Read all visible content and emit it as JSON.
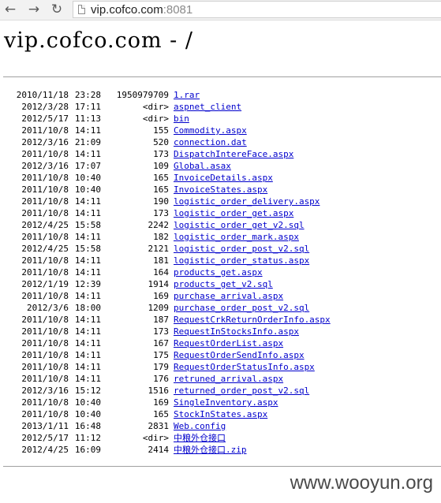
{
  "browser": {
    "back_icon": "arrow-left-icon",
    "forward_icon": "arrow-right-icon",
    "reload_icon": "reload-icon",
    "url_host": "vip.cofco.com",
    "url_port": ":8081"
  },
  "page": {
    "title": "vip.cofco.com - /"
  },
  "listing": [
    {
      "date": "2010/11/18",
      "time": "23:28",
      "size": "1950979709",
      "name": "1.rar"
    },
    {
      "date": "2012/3/28",
      "time": "17:11",
      "size": "<dir>",
      "name": "aspnet_client"
    },
    {
      "date": "2012/5/17",
      "time": "11:13",
      "size": "<dir>",
      "name": "bin"
    },
    {
      "date": "2011/10/8",
      "time": "14:11",
      "size": "155",
      "name": "Commodity.aspx"
    },
    {
      "date": "2012/3/16",
      "time": "21:09",
      "size": "520",
      "name": "connection.dat"
    },
    {
      "date": "2011/10/8",
      "time": "14:11",
      "size": "173",
      "name": "DispatchIntereFace.aspx"
    },
    {
      "date": "2012/3/16",
      "time": "17:07",
      "size": "109",
      "name": "Global.asax"
    },
    {
      "date": "2011/10/8",
      "time": "10:40",
      "size": "165",
      "name": "InvoiceDetails.aspx"
    },
    {
      "date": "2011/10/8",
      "time": "10:40",
      "size": "165",
      "name": "InvoiceStates.aspx"
    },
    {
      "date": "2011/10/8",
      "time": "14:11",
      "size": "190",
      "name": "logistic_order_delivery.aspx"
    },
    {
      "date": "2011/10/8",
      "time": "14:11",
      "size": "173",
      "name": "logistic_order_get.aspx"
    },
    {
      "date": "2012/4/25",
      "time": "15:58",
      "size": "2242",
      "name": "logistic_order_get_v2.sql"
    },
    {
      "date": "2011/10/8",
      "time": "14:11",
      "size": "182",
      "name": "logistic_order_mark.aspx"
    },
    {
      "date": "2012/4/25",
      "time": "15:58",
      "size": "2121",
      "name": "logistic_order_post_v2.sql"
    },
    {
      "date": "2011/10/8",
      "time": "14:11",
      "size": "181",
      "name": "logistic_order_status.aspx"
    },
    {
      "date": "2011/10/8",
      "time": "14:11",
      "size": "164",
      "name": "products_get.aspx"
    },
    {
      "date": "2012/1/19",
      "time": "12:39",
      "size": "1914",
      "name": "products_get_v2.sql"
    },
    {
      "date": "2011/10/8",
      "time": "14:11",
      "size": "169",
      "name": "purchase_arrival.aspx"
    },
    {
      "date": "2012/3/6",
      "time": "18:00",
      "size": "1209",
      "name": "purchase_order_post_v2.sql"
    },
    {
      "date": "2011/10/8",
      "time": "14:11",
      "size": "187",
      "name": "RequestCrkReturnOrderInfo.aspx"
    },
    {
      "date": "2011/10/8",
      "time": "14:11",
      "size": "173",
      "name": "RequestInStocksInfo.aspx"
    },
    {
      "date": "2011/10/8",
      "time": "14:11",
      "size": "167",
      "name": "RequestOrderList.aspx"
    },
    {
      "date": "2011/10/8",
      "time": "14:11",
      "size": "175",
      "name": "RequestOrderSendInfo.aspx"
    },
    {
      "date": "2011/10/8",
      "time": "14:11",
      "size": "179",
      "name": "RequestOrderStatusInfo.aspx"
    },
    {
      "date": "2011/10/8",
      "time": "14:11",
      "size": "176",
      "name": "retruned_arrival.aspx"
    },
    {
      "date": "2012/3/16",
      "time": "15:12",
      "size": "1516",
      "name": "returned_order_post_v2.sql"
    },
    {
      "date": "2011/10/8",
      "time": "10:40",
      "size": "169",
      "name": "SingleInventory.aspx"
    },
    {
      "date": "2011/10/8",
      "time": "10:40",
      "size": "165",
      "name": "StockInStates.aspx"
    },
    {
      "date": "2013/1/11",
      "time": "16:48",
      "size": "2831",
      "name": "Web.config"
    },
    {
      "date": "2012/5/17",
      "time": "11:12",
      "size": "<dir>",
      "name": "中粮外仓接口"
    },
    {
      "date": "2012/4/25",
      "time": "16:09",
      "size": "2414",
      "name": "中粮外仓接口.zip"
    }
  ],
  "watermark": "www.wooyun.org",
  "colors": {
    "link": "#0000cc",
    "toolbar": "#f2f2f2",
    "rule": "#a0a0a0"
  }
}
